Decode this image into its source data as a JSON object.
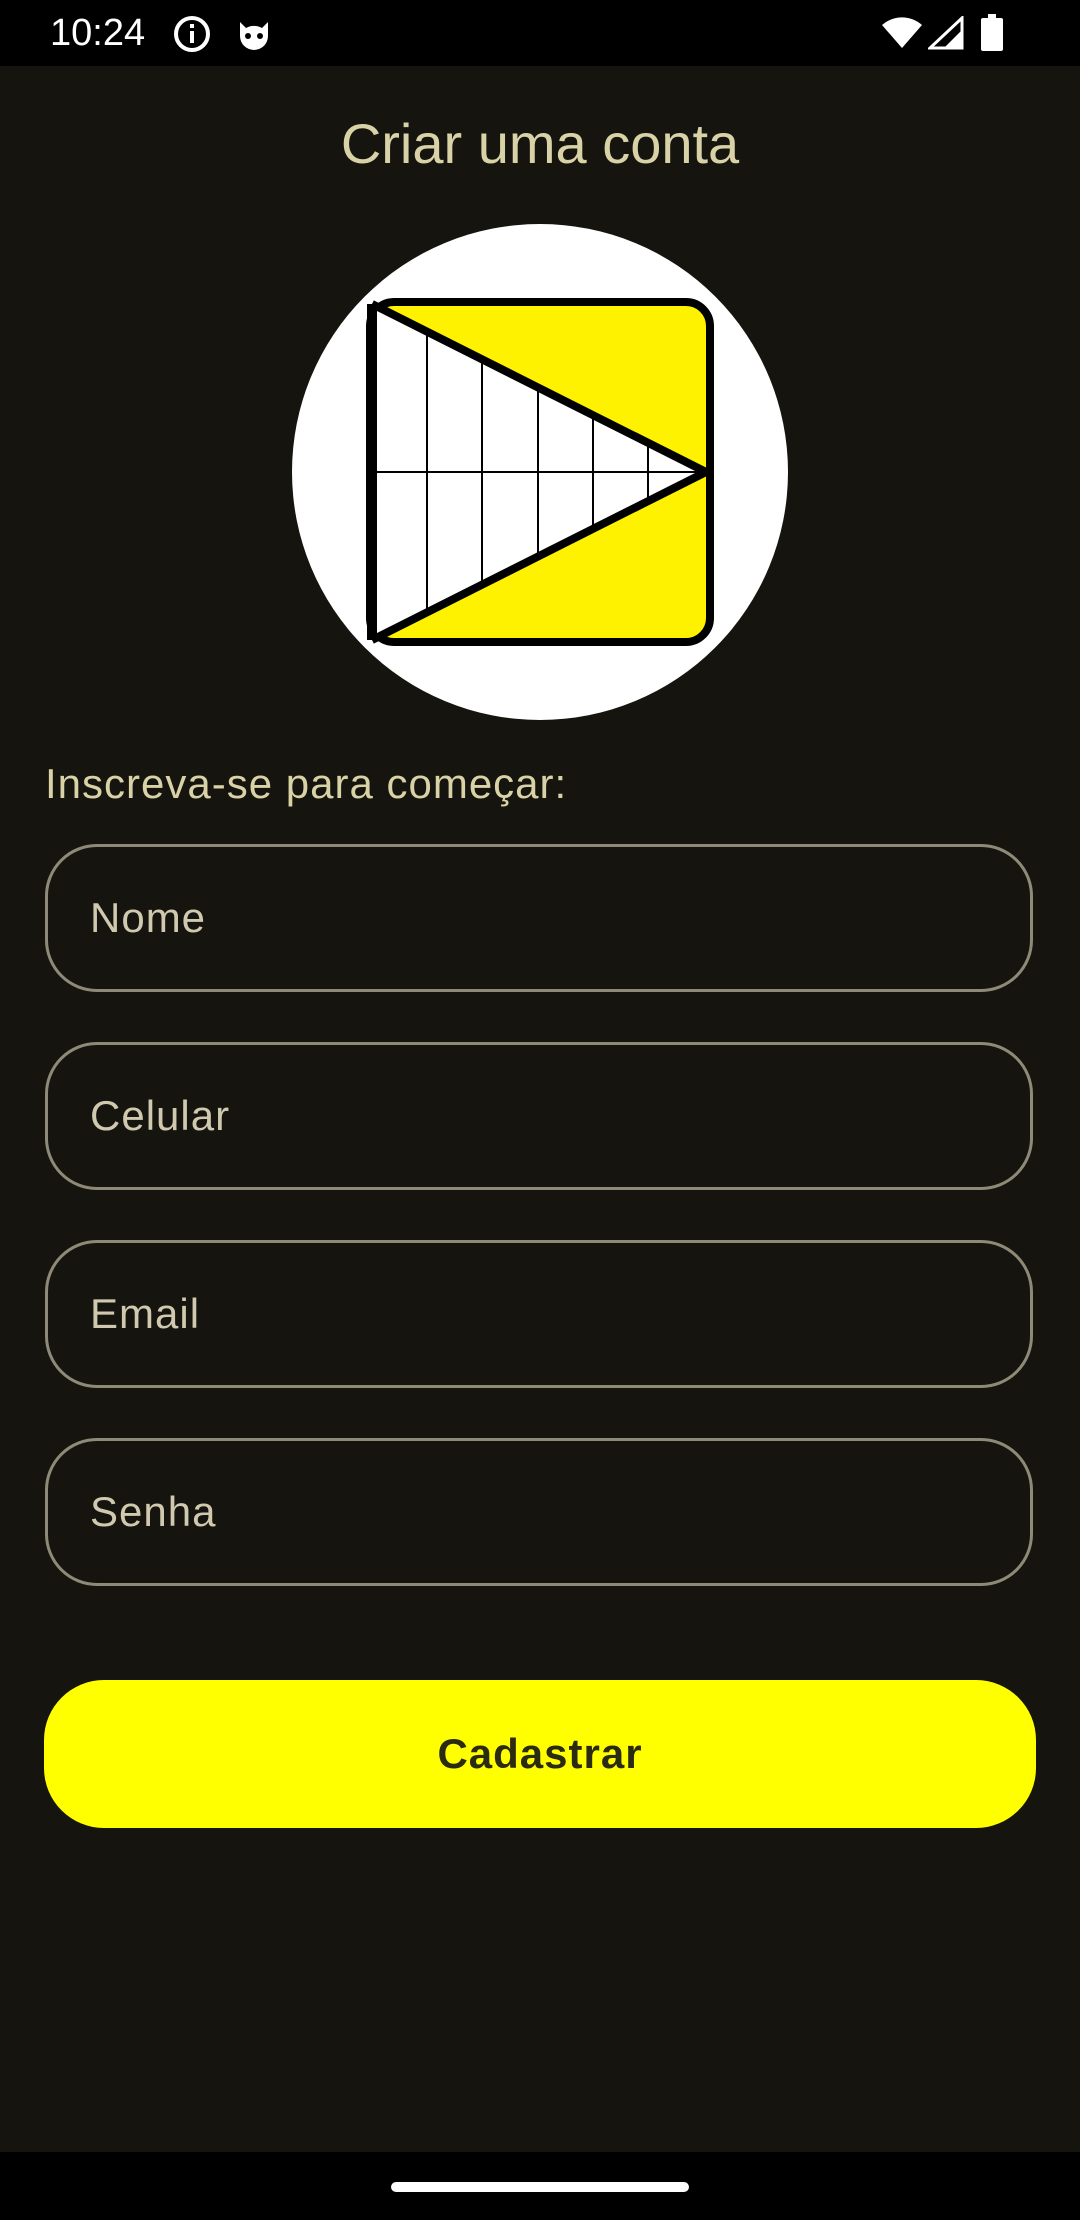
{
  "status_bar": {
    "time": "10:24",
    "icons_left": [
      "info-icon",
      "cat-face-icon"
    ],
    "icons_right": [
      "wifi-icon",
      "signal-icon",
      "battery-icon"
    ]
  },
  "screen": {
    "title": "Criar uma conta",
    "logo": "app-logo-icon",
    "subtitle": "Inscreva-se para começar:",
    "fields": {
      "name_placeholder": "Nome",
      "phone_placeholder": "Celular",
      "email_placeholder": "Email",
      "password_placeholder": "Senha"
    },
    "submit_label": "Cadastrar"
  },
  "colors": {
    "background": "#15140e",
    "accent": "#ffff00",
    "text": "#d9d2a6",
    "field_border": "#8e8a78"
  }
}
